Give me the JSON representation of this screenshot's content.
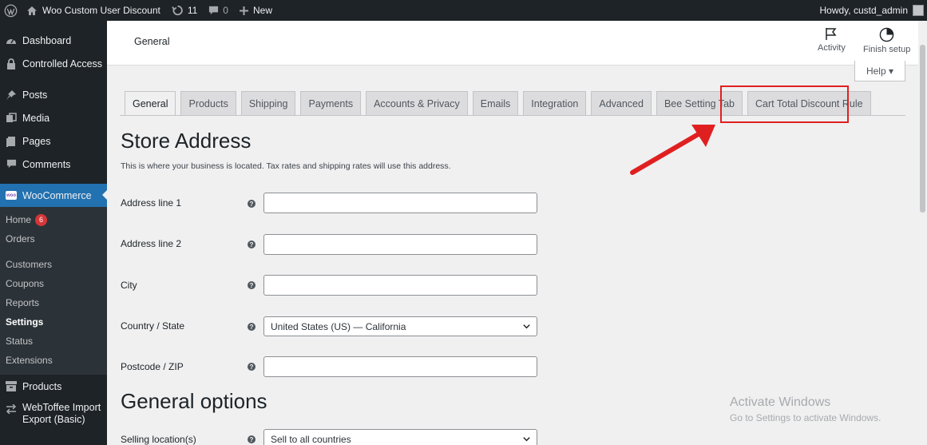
{
  "admin_bar": {
    "site_name": "Woo Custom User Discount",
    "updates_count": "11",
    "comments_count": "0",
    "new_label": "New",
    "greeting": "Howdy, custd_admin"
  },
  "sidebar": {
    "items_top": [
      {
        "label": "Dashboard",
        "icon": "dashboard-icon"
      },
      {
        "label": "Controlled Access",
        "icon": "lock-icon"
      },
      {
        "label": "Posts",
        "icon": "pin-icon"
      },
      {
        "label": "Media",
        "icon": "media-icon"
      },
      {
        "label": "Pages",
        "icon": "pages-icon"
      },
      {
        "label": "Comments",
        "icon": "comments-icon"
      }
    ],
    "woocommerce_label": "WooCommerce",
    "woo_badge": "woo",
    "submenu": [
      {
        "label": "Home",
        "badge": "6"
      },
      {
        "label": "Orders"
      },
      {
        "label": "Customers"
      },
      {
        "label": "Coupons"
      },
      {
        "label": "Reports"
      },
      {
        "label": "Settings"
      },
      {
        "label": "Status"
      },
      {
        "label": "Extensions"
      }
    ],
    "items_bottom": [
      {
        "label": "Products",
        "icon": "archive-icon"
      },
      {
        "label": "WebToffee Import Export (Basic)",
        "icon": "import-export-icon"
      }
    ]
  },
  "header": {
    "title": "General",
    "activity_label": "Activity",
    "finish_setup_label": "Finish setup",
    "help_label": "Help ▾"
  },
  "tabs": [
    "General",
    "Products",
    "Shipping",
    "Payments",
    "Accounts & Privacy",
    "Emails",
    "Integration",
    "Advanced",
    "Bee Setting Tab",
    "Cart Total Discount Rule"
  ],
  "active_tab": "General",
  "store_address": {
    "title": "Store Address",
    "description": "This is where your business is located. Tax rates and shipping rates will use this address.",
    "fields": [
      {
        "label": "Address line 1",
        "value": ""
      },
      {
        "label": "Address line 2",
        "value": ""
      },
      {
        "label": "City",
        "value": ""
      },
      {
        "label": "Country / State",
        "value": "United States (US) — California"
      },
      {
        "label": "Postcode / ZIP",
        "value": ""
      }
    ]
  },
  "general_options": {
    "title": "General options",
    "selling_location_label": "Selling location(s)",
    "selling_location_value": "Sell to all countries"
  },
  "watermark": {
    "line1": "Activate Windows",
    "line2": "Go to Settings to activate Windows."
  },
  "help_glyph": "?",
  "colors": {
    "accent": "#2271b1",
    "highlight": "#e02020",
    "badge": "#d63638"
  }
}
